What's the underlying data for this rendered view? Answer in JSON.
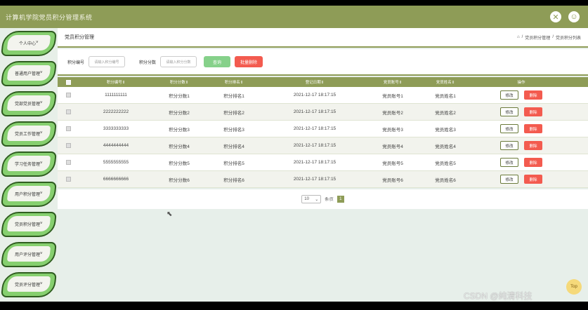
{
  "app": {
    "title": "计算机学院党员积分管理系统"
  },
  "header_icons": [
    "close-icon",
    "user-icon"
  ],
  "sidebar": {
    "items": [
      {
        "label": "个人中心"
      },
      {
        "label": "普通用户管理"
      },
      {
        "label": "党部党员管理"
      },
      {
        "label": "党员工作管理"
      },
      {
        "label": "学习任务管理"
      },
      {
        "label": "用户积分管理"
      },
      {
        "label": "党员积分管理"
      },
      {
        "label": "用户评分管理"
      },
      {
        "label": "党员评分管理"
      }
    ]
  },
  "page": {
    "title": "党员积分管理",
    "breadcrumb": [
      "党员积分管理",
      "党员积分列表"
    ]
  },
  "search": {
    "field1_label": "积分编号",
    "field1_placeholder": "请输入积分编号",
    "field2_label": "积分分数",
    "field2_placeholder": "请输入积分分数",
    "query_label": "查询",
    "bulk_delete_label": "批量删除"
  },
  "table": {
    "headers": [
      "积分编号",
      "积分分数",
      "积分排名",
      "登记日期",
      "党员账号",
      "党员姓名",
      "操作"
    ],
    "edit_label": "修改",
    "delete_label": "删除",
    "rows": [
      {
        "id": "1111111111",
        "score": "积分分数1",
        "rank": "积分排名1",
        "date": "2021-12-17 18:17:15",
        "account": "党员账号1",
        "name": "党员姓名1"
      },
      {
        "id": "2222222222",
        "score": "积分分数2",
        "rank": "积分排名2",
        "date": "2021-12-17 18:17:15",
        "account": "党员账号2",
        "name": "党员姓名2"
      },
      {
        "id": "3333333333",
        "score": "积分分数3",
        "rank": "积分排名3",
        "date": "2021-12-17 18:17:15",
        "account": "党员账号3",
        "name": "党员姓名3"
      },
      {
        "id": "4444444444",
        "score": "积分分数4",
        "rank": "积分排名4",
        "date": "2021-12-17 18:17:15",
        "account": "党员账号4",
        "name": "党员姓名4"
      },
      {
        "id": "5555555555",
        "score": "积分分数5",
        "rank": "积分排名5",
        "date": "2021-12-17 18:17:15",
        "account": "党员账号5",
        "name": "党员姓名5"
      },
      {
        "id": "6666666666",
        "score": "积分分数6",
        "rank": "积分排名6",
        "date": "2021-12-17 18:17:15",
        "account": "党员账号6",
        "name": "党员姓名6"
      }
    ]
  },
  "pagination": {
    "page_size": "10",
    "page_size_unit": "条/页",
    "current_page": "1"
  },
  "top_button": "Top",
  "watermark": "CSDN @纯清科技"
}
